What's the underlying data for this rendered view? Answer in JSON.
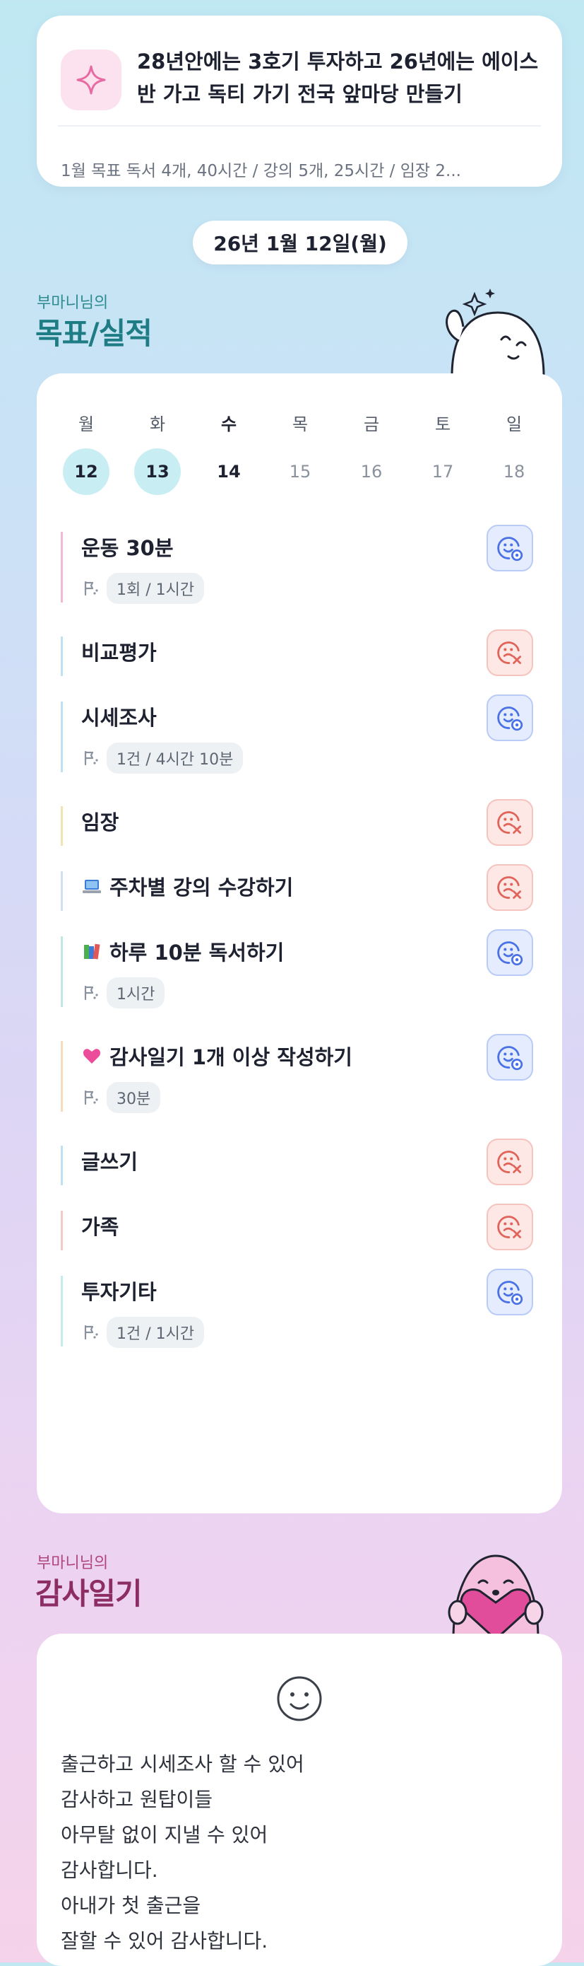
{
  "goal": {
    "title": "28년안에는 3호기 투자하고 26년에는 에이스반 가고 독티 가기 전국 앞마당 만들기",
    "summary": "1월 목표  독서 4개, 40시간 / 강의 5개, 25시간 / 임장 2..."
  },
  "date_label": "26년 1월 12일(월)",
  "goals_section": {
    "subtitle": "부마니님의",
    "title": "목표/실적"
  },
  "week": [
    {
      "day": "월",
      "num": "12",
      "state": "done"
    },
    {
      "day": "화",
      "num": "13",
      "state": "done"
    },
    {
      "day": "수",
      "num": "14",
      "state": "today"
    },
    {
      "day": "목",
      "num": "15",
      "state": "future"
    },
    {
      "day": "금",
      "num": "16",
      "state": "future"
    },
    {
      "day": "토",
      "num": "17",
      "state": "future"
    },
    {
      "day": "일",
      "num": "18",
      "state": "future"
    }
  ],
  "tasks": [
    {
      "name": "운동 30분",
      "emoji": "",
      "meta": "1회 / 1시간",
      "status": "done",
      "accent": "#f5b8d2"
    },
    {
      "name": "비교평가",
      "emoji": "",
      "meta": "",
      "status": "missed",
      "accent": "#bfe1f1"
    },
    {
      "name": "시세조사",
      "emoji": "",
      "meta": "1건 / 4시간 10분",
      "status": "done",
      "accent": "#bfe1f1"
    },
    {
      "name": "임장",
      "emoji": "",
      "meta": "",
      "status": "missed",
      "accent": "#f1e3b3"
    },
    {
      "name": "주차별 강의 수강하기",
      "emoji": "laptop-icon",
      "meta": "",
      "status": "missed",
      "accent": "#cfe0f3"
    },
    {
      "name": "하루 10분 독서하기",
      "emoji": "books-icon",
      "meta": "1시간",
      "status": "done",
      "accent": "#bfe8e0"
    },
    {
      "name": "감사일기 1개 이상 작성하기",
      "emoji": "heart-icon",
      "meta": "30분",
      "status": "done",
      "accent": "#f6dcb8"
    },
    {
      "name": "글쓰기",
      "emoji": "",
      "meta": "",
      "status": "missed",
      "accent": "#bfe1f1"
    },
    {
      "name": "가족",
      "emoji": "",
      "meta": "",
      "status": "missed",
      "accent": "#f6c9c2"
    },
    {
      "name": "투자기타",
      "emoji": "",
      "meta": "1건 / 1시간",
      "status": "done",
      "accent": "#c4ecea"
    }
  ],
  "thanks_section": {
    "subtitle": "부마니님의",
    "title": "감사일기"
  },
  "thanks_lines": [
    "출근하고 시세조사 할 수 있어",
    "감사하고 원탑이들",
    "아무탈 없이 지낼 수 있어",
    "감사합니다.",
    "아내가 첫 출근을",
    "잘할 수 있어 감사합니다."
  ],
  "colors": {
    "ok": "#4a72e6",
    "missed": "#e0645a",
    "accent_teal": "#1e7d84",
    "accent_plum": "#8c2d66"
  }
}
